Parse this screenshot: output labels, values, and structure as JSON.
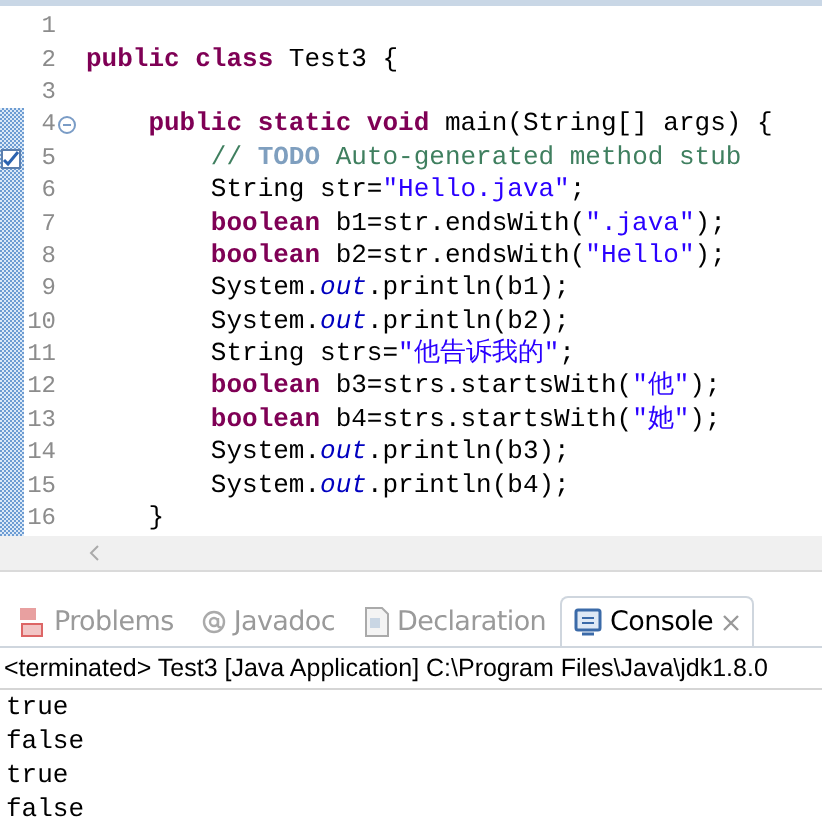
{
  "editor": {
    "lines": [
      {
        "number": "1",
        "kind": "plain"
      },
      {
        "number": "2",
        "kind": "plain",
        "segments": [
          {
            "kind": "keyword",
            "text": "public class"
          },
          {
            "kind": "plain",
            "text": " Test3 {"
          }
        ]
      },
      {
        "number": "3",
        "kind": "plain"
      },
      {
        "number": "4",
        "kind": "method",
        "segments": [
          {
            "kind": "keyword",
            "text": "    public static void"
          },
          {
            "kind": "plain",
            "text": " main(String[] args) {"
          }
        ]
      },
      {
        "number": "5",
        "kind": "task",
        "segments": [
          {
            "kind": "comment",
            "text": "        // "
          },
          {
            "kind": "todo",
            "text": "TODO"
          },
          {
            "kind": "comment",
            "text": " Auto-generated method stub"
          }
        ]
      },
      {
        "number": "6",
        "kind": "plain",
        "segments": [
          {
            "kind": "plain",
            "text": "        String str="
          },
          {
            "kind": "string",
            "text": "\"Hello.java\""
          },
          {
            "kind": "plain",
            "text": ";"
          }
        ]
      },
      {
        "number": "7",
        "kind": "plain",
        "segments": [
          {
            "kind": "keyword",
            "text": "        boolean"
          },
          {
            "kind": "plain",
            "text": " b1=str.endsWith("
          },
          {
            "kind": "string",
            "text": "\".java\""
          },
          {
            "kind": "plain",
            "text": ");"
          }
        ]
      },
      {
        "number": "8",
        "kind": "plain",
        "segments": [
          {
            "kind": "keyword",
            "text": "        boolean"
          },
          {
            "kind": "plain",
            "text": " b2=str.endsWith("
          },
          {
            "kind": "string",
            "text": "\"Hello\""
          },
          {
            "kind": "plain",
            "text": ");"
          }
        ]
      },
      {
        "number": "9",
        "kind": "plain",
        "segments": [
          {
            "kind": "plain",
            "text": "        System."
          },
          {
            "kind": "field",
            "text": "out"
          },
          {
            "kind": "plain",
            "text": ".println(b1);"
          }
        ]
      },
      {
        "number": "10",
        "kind": "plain",
        "segments": [
          {
            "kind": "plain",
            "text": "        System."
          },
          {
            "kind": "field",
            "text": "out"
          },
          {
            "kind": "plain",
            "text": ".println(b2);"
          }
        ]
      },
      {
        "number": "11",
        "kind": "plain",
        "segments": [
          {
            "kind": "plain",
            "text": "        String strs="
          },
          {
            "kind": "string",
            "text": "\"他告诉我的\""
          },
          {
            "kind": "plain",
            "text": ";"
          }
        ]
      },
      {
        "number": "12",
        "kind": "plain",
        "segments": [
          {
            "kind": "keyword",
            "text": "        boolean"
          },
          {
            "kind": "plain",
            "text": " b3=strs.startsWith("
          },
          {
            "kind": "string",
            "text": "\"他\""
          },
          {
            "kind": "plain",
            "text": ");"
          }
        ]
      },
      {
        "number": "13",
        "kind": "plain",
        "segments": [
          {
            "kind": "keyword",
            "text": "        boolean"
          },
          {
            "kind": "plain",
            "text": " b4=strs.startsWith("
          },
          {
            "kind": "string",
            "text": "\"她\""
          },
          {
            "kind": "plain",
            "text": ");"
          }
        ]
      },
      {
        "number": "14",
        "kind": "plain",
        "segments": [
          {
            "kind": "plain",
            "text": "        System."
          },
          {
            "kind": "field",
            "text": "out"
          },
          {
            "kind": "plain",
            "text": ".println(b3);"
          }
        ]
      },
      {
        "number": "15",
        "kind": "plain",
        "segments": [
          {
            "kind": "plain",
            "text": "        System."
          },
          {
            "kind": "field",
            "text": "out"
          },
          {
            "kind": "plain",
            "text": ".println(b4);"
          }
        ]
      },
      {
        "number": "16",
        "kind": "plain",
        "segments": [
          {
            "kind": "plain",
            "text": "    }"
          }
        ]
      }
    ]
  },
  "tabs": [
    {
      "label": "Problems",
      "kind": "problems",
      "selected": false
    },
    {
      "label": "Javadoc",
      "kind": "javadoc",
      "selected": false
    },
    {
      "label": "Declaration",
      "kind": "declaration",
      "selected": false
    },
    {
      "label": "Console",
      "kind": "console",
      "selected": true
    }
  ],
  "console": {
    "status": "<terminated> Test3 [Java Application] C:\\Program Files\\Java\\jdk1.8.0",
    "output": [
      "true",
      "false",
      "true",
      "false"
    ]
  }
}
